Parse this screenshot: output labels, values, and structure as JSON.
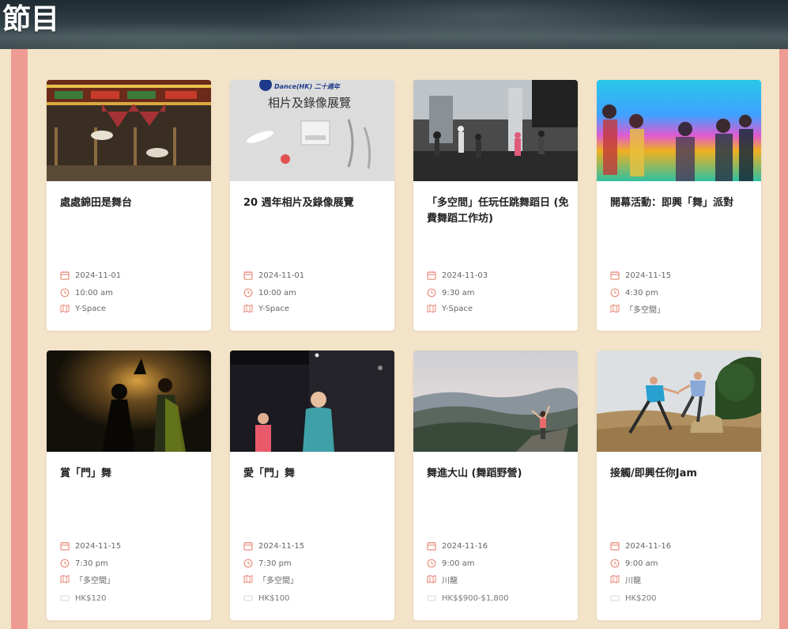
{
  "page": {
    "title": "節目"
  },
  "theme": {
    "accent": "#ee9b93",
    "background": "#f3e4c9",
    "icon_color": "#e8907f"
  },
  "events": [
    {
      "title": "處處錦田是舞台",
      "date": "2024-11-01",
      "time": "10:00 am",
      "venue": "Y-Space",
      "price": ""
    },
    {
      "title": "20 週年相片及錄像展覽",
      "date": "2024-11-01",
      "time": "10:00 am",
      "venue": "Y-Space",
      "price": "",
      "poster_text": {
        "line1": "Dance(HK)  二十週年",
        "line2": "相片及錄像展覽"
      }
    },
    {
      "title": "「多空間」任玩任跳舞蹈日 (免費舞蹈工作坊)",
      "date": "2024-11-03",
      "time": "9:30 am",
      "venue": "Y-Space",
      "price": ""
    },
    {
      "title": "開幕活動：即興「舞」派對",
      "date": "2024-11-15",
      "time": "4:30 pm",
      "venue": "「多空間」",
      "price": ""
    },
    {
      "title": "賞「門」舞",
      "date": "2024-11-15",
      "time": "7:30 pm",
      "venue": "「多空間」",
      "price": "HK$120"
    },
    {
      "title": "愛「門」舞",
      "date": "2024-11-15",
      "time": "7:30 pm",
      "venue": "「多空間」",
      "price": "HK$100"
    },
    {
      "title": "舞進大山 (舞蹈野營)",
      "date": "2024-11-16",
      "time": "9:00 am",
      "venue": "川龍",
      "price": "HK$$900-$1,800"
    },
    {
      "title": "接觸/即興任你Jam",
      "date": "2024-11-16",
      "time": "9:00 am",
      "venue": "川龍",
      "price": "HK$200"
    }
  ]
}
